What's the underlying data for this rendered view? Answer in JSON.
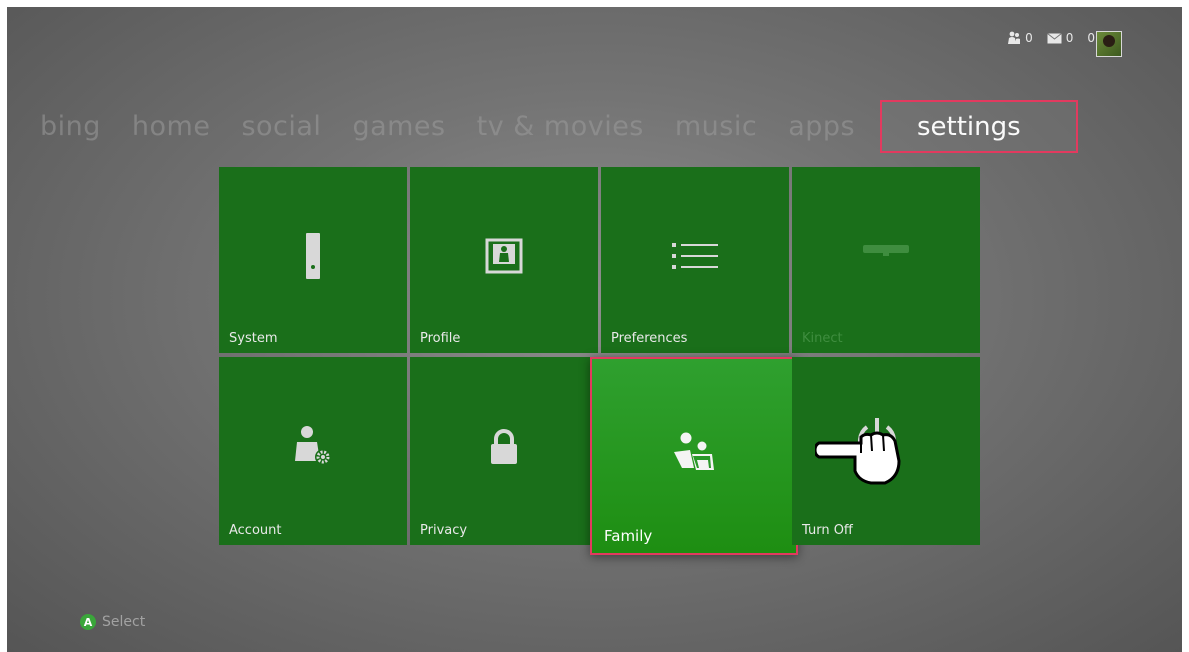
{
  "status": {
    "friends_count": "0",
    "messages_count": "0",
    "gamerscore": "0"
  },
  "nav": {
    "items": [
      "bing",
      "home",
      "social",
      "games",
      "tv & movies",
      "music",
      "apps"
    ],
    "selected": "settings"
  },
  "tiles": [
    {
      "label": "System",
      "icon": "console-icon"
    },
    {
      "label": "Profile",
      "icon": "profile-icon"
    },
    {
      "label": "Preferences",
      "icon": "list-icon"
    },
    {
      "label": "Kinect",
      "icon": "kinect-icon"
    },
    {
      "label": "Account",
      "icon": "account-gear-icon"
    },
    {
      "label": "Privacy",
      "icon": "lock-icon"
    },
    {
      "label": "Family",
      "icon": "family-icon"
    },
    {
      "label": "Turn Off",
      "icon": "power-icon"
    }
  ],
  "hint": {
    "button": "A",
    "label": "Select"
  },
  "colors": {
    "tile_green": "#1a6f1a",
    "selected_green": "#2fa02f",
    "highlight": "#e23a5f"
  }
}
